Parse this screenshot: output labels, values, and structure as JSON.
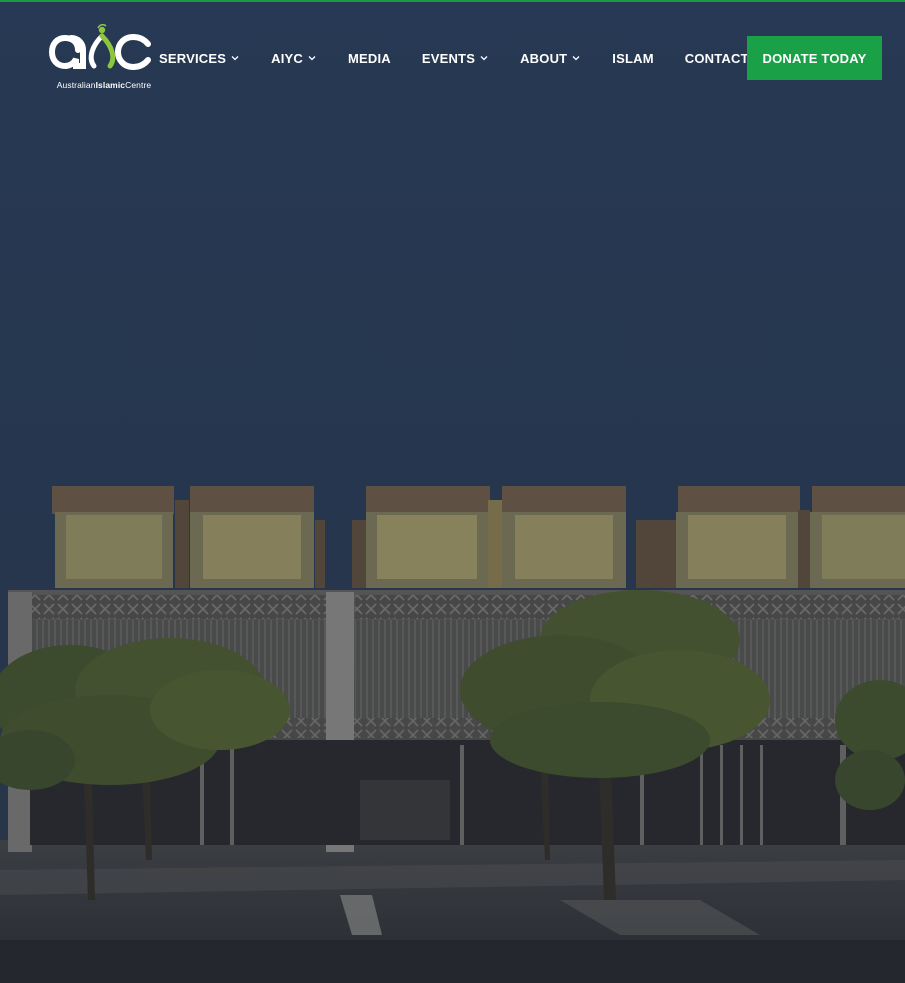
{
  "brand": {
    "logo_caption_part1": "Australian",
    "logo_caption_part2": "Islamic",
    "logo_caption_part3": "Centre",
    "accent_color": "#1aa046",
    "logo_green": "#8cc63f"
  },
  "nav": {
    "items": [
      {
        "label": "SERVICES",
        "has_dropdown": true
      },
      {
        "label": "AIYC",
        "has_dropdown": true
      },
      {
        "label": "MEDIA",
        "has_dropdown": false
      },
      {
        "label": "EVENTS",
        "has_dropdown": true
      },
      {
        "label": "ABOUT",
        "has_dropdown": true
      },
      {
        "label": "ISLAM",
        "has_dropdown": false
      },
      {
        "label": "CONTACT",
        "has_dropdown": false
      }
    ],
    "cta_label": "DONATE TODAY"
  },
  "icons": [
    "chevron-down-icon"
  ]
}
